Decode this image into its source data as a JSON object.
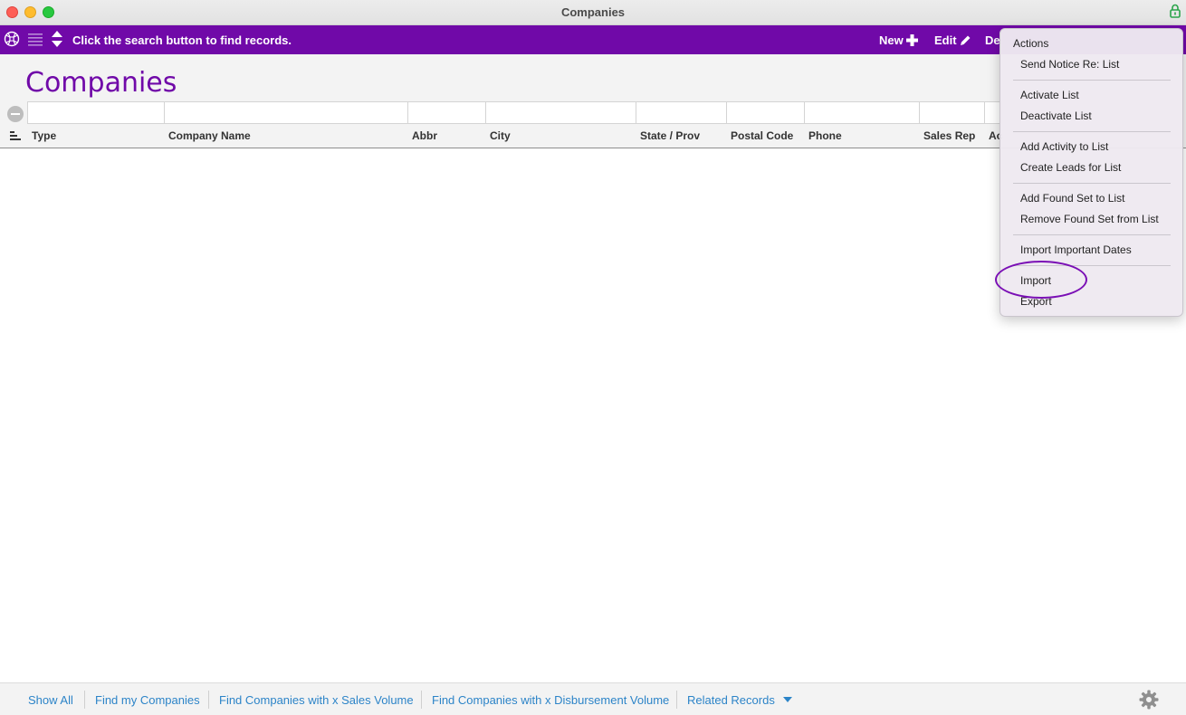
{
  "window": {
    "title": "Companies"
  },
  "toolbar": {
    "status": "Click the search button to find records.",
    "new_label": "New",
    "edit_label": "Edit",
    "delete_label": "De"
  },
  "header": {
    "title": "Companies"
  },
  "columns": [
    "Type",
    "Company Name",
    "Abbr",
    "City",
    "State / Prov",
    "Postal Code",
    "Phone",
    "Sales Rep",
    "Ac"
  ],
  "menu": {
    "heading": "Actions",
    "items": [
      "Send Notice Re: List",
      "Activate List",
      "Deactivate List",
      "Add Activity to List",
      "Create Leads for List",
      "Add Found Set to List",
      "Remove Found Set from List",
      "Import Important Dates",
      "Import",
      "Export"
    ]
  },
  "footer": {
    "links": [
      "Show All",
      "Find my Companies",
      "Find Companies with x Sales Volume",
      "Find Companies with x Disbursement Volume",
      "Related Records"
    ]
  },
  "colors": {
    "accent": "#7009a8",
    "link": "#2c84c8"
  },
  "icons": [
    "globe-icon",
    "list-icon",
    "sort-arrows-icon",
    "plus-icon",
    "pencil-icon",
    "lock-icon",
    "chevron-down-icon",
    "gear-icon",
    "sort-lines-icon"
  ]
}
